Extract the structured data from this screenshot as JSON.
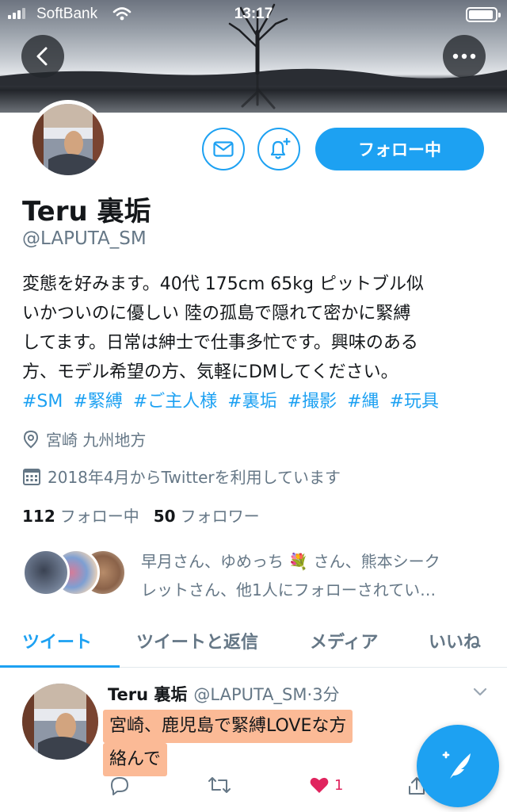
{
  "status_bar": {
    "carrier": "SoftBank",
    "time": "13:17"
  },
  "header": {
    "back_icon": "chevron-left-icon",
    "more_icon": "more-horizontal-icon"
  },
  "profile": {
    "name": "Teru 裏垢",
    "handle": "@LAPUTA_SM",
    "follow_button_label": "フォロー中",
    "bio_lines": [
      "変態を好みます。40代 175cm 65kg ピットブル似",
      "いかついのに優しい 陸の孤島で隠れて密かに緊縛",
      "してます。日常は紳士で仕事多忙です。興味のある",
      "方、モデル希望の方、気軽にDMしてください。"
    ],
    "hashtags": [
      "#SM",
      "#緊縛",
      "#ご主人様",
      "#裏垢",
      "#撮影",
      "#縄",
      "#玩具"
    ],
    "location": "宮崎 九州地方",
    "joined": "2018年4月からTwitterを利用しています",
    "following_count": "112",
    "following_label": "フォロー中",
    "followers_count": "50",
    "followers_label": "フォロワー",
    "followed_by_lines": [
      "早月さん、ゆめっち 💐 さん、熊本シーク",
      "レットさん、他1人にフォローされてい…"
    ]
  },
  "tabs": [
    {
      "label": "ツイート",
      "active": true
    },
    {
      "label": "ツイートと返信",
      "active": false
    },
    {
      "label": "メディア",
      "active": false
    },
    {
      "label": "いいね",
      "active": false
    }
  ],
  "tweet": {
    "name": "Teru 裏垢",
    "handle": "@LAPUTA_SM",
    "separator": "·",
    "time": "3分",
    "text_line1": "宮崎、鹿児島で緊縛LOVEな方",
    "text_line2": "絡んで",
    "like_count": "1"
  },
  "colors": {
    "accent": "#1da1f2",
    "like": "#e0245e",
    "highlight": "#faa06e"
  }
}
